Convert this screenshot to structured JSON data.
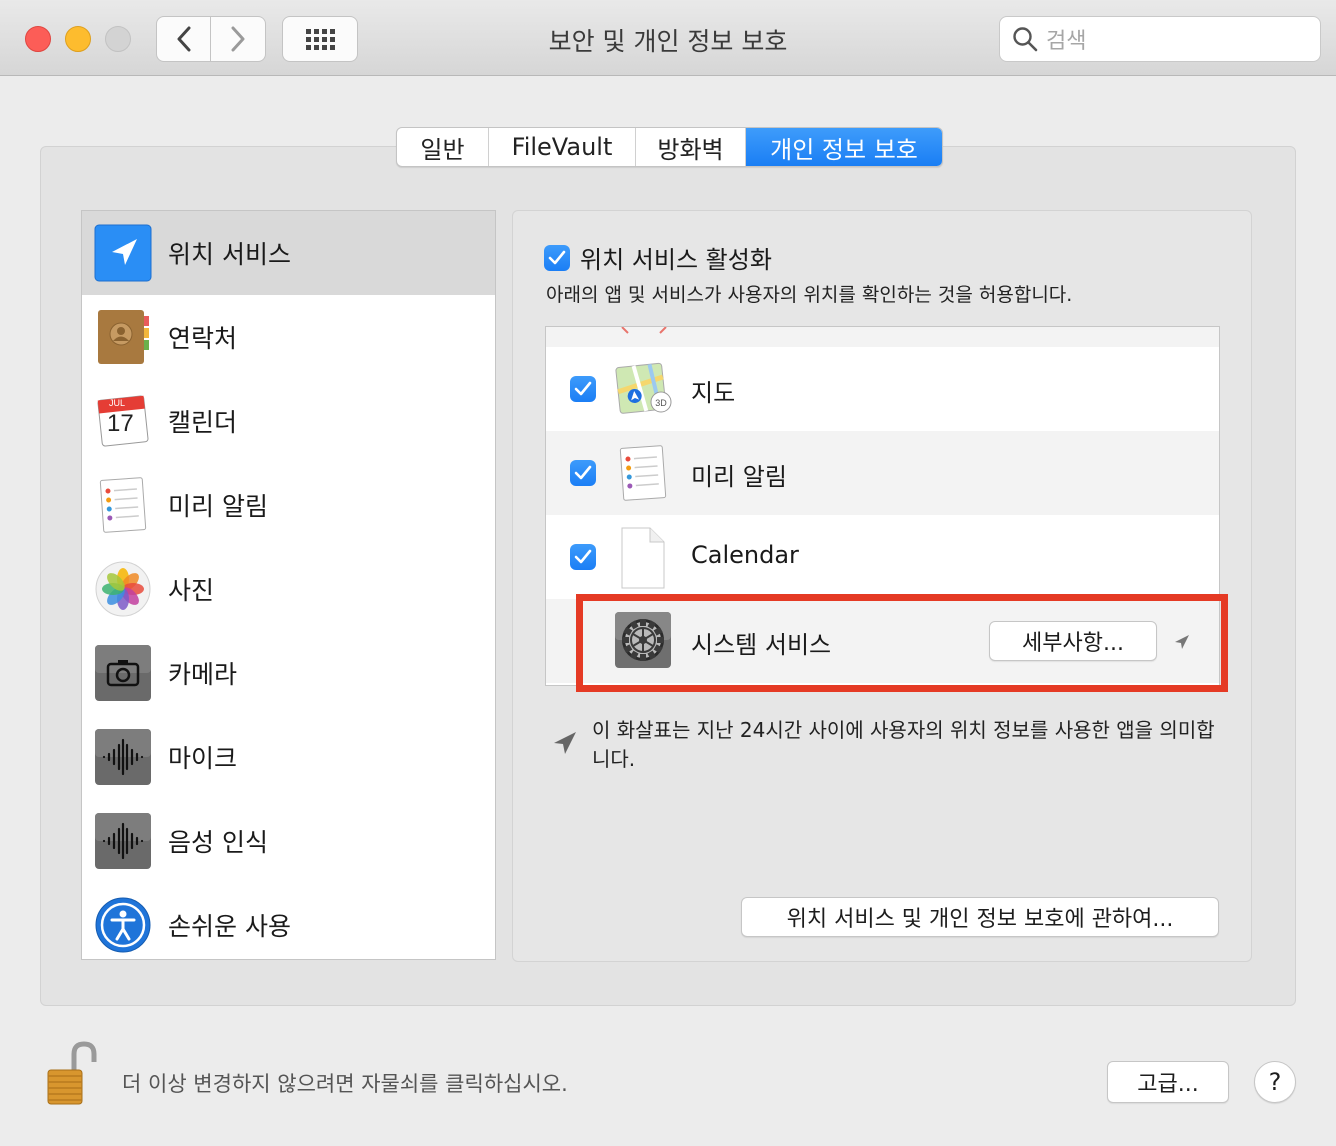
{
  "window": {
    "title": "보안 및 개인 정보 보호",
    "search_placeholder": "검색"
  },
  "tabs": [
    {
      "label": "일반",
      "active": false
    },
    {
      "label": "FileVault",
      "active": false
    },
    {
      "label": "방화벽",
      "active": false
    },
    {
      "label": "개인 정보 보호",
      "active": true
    }
  ],
  "sidebar": {
    "items": [
      {
        "label": "위치 서비스",
        "icon": "location-icon",
        "selected": true
      },
      {
        "label": "연락처",
        "icon": "contacts-icon",
        "selected": false
      },
      {
        "label": "캘린더",
        "icon": "calendar-icon",
        "selected": false,
        "icon_month": "JUL",
        "icon_day": "17"
      },
      {
        "label": "미리 알림",
        "icon": "reminders-icon",
        "selected": false
      },
      {
        "label": "사진",
        "icon": "photos-icon",
        "selected": false
      },
      {
        "label": "카메라",
        "icon": "camera-icon",
        "selected": false
      },
      {
        "label": "마이크",
        "icon": "microphone-icon",
        "selected": false
      },
      {
        "label": "음성 인식",
        "icon": "speech-recognition-icon",
        "selected": false
      },
      {
        "label": "손쉬운 사용",
        "icon": "accessibility-icon",
        "selected": false
      }
    ]
  },
  "location": {
    "enable_label": "위치 서비스 활성화",
    "enabled": true,
    "description": "아래의 앱 및 서비스가 사용자의 위치를 확인하는 것을 허용합니다.",
    "apps": [
      {
        "label": "지도",
        "icon": "maps-icon",
        "checked": true
      },
      {
        "label": "미리 알림",
        "icon": "reminders-icon",
        "checked": true
      },
      {
        "label": "Calendar",
        "icon": "document-icon",
        "checked": true
      },
      {
        "label": "시스템 서비스",
        "icon": "system-preferences-gear-icon",
        "details_label": "세부사항...",
        "recent_use_arrow": true
      }
    ],
    "note": "이 화살표는 지난 24시간 사이에 사용자의 위치 정보를 사용한 앱을 의미합니다.",
    "about_button": "위치 서비스 및 개인 정보 보호에 관하여..."
  },
  "footer": {
    "lock_text": "더 이상 변경하지 않으려면 자물쇠를 클릭하십시오.",
    "advanced_button": "고급...",
    "help_button": "?"
  },
  "colors": {
    "accent": "#1a7ef4",
    "highlight_box": "#e53a24"
  }
}
